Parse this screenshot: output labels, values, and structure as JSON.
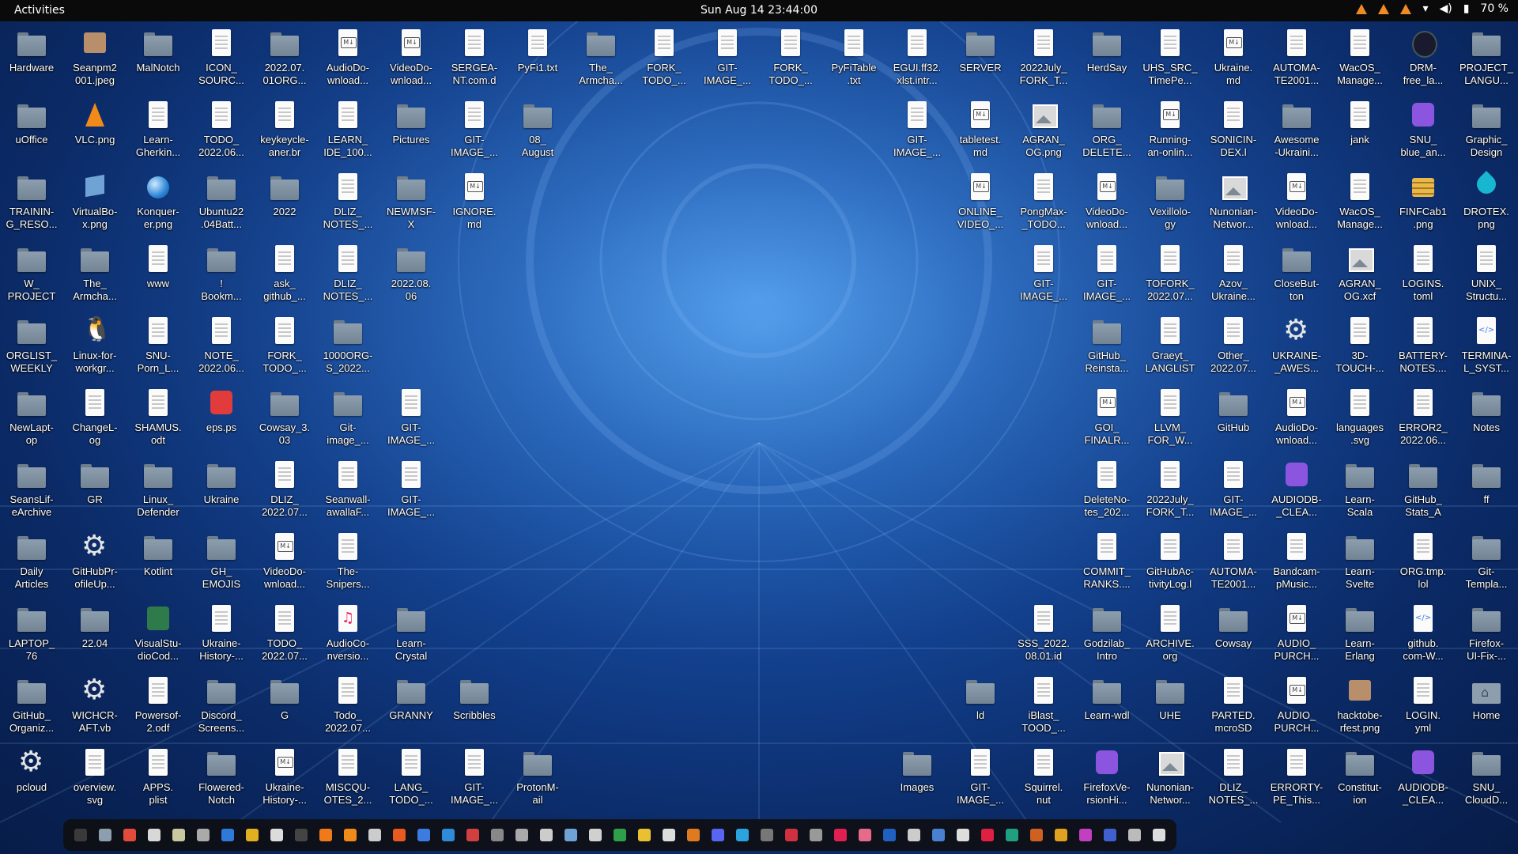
{
  "topbar": {
    "activities": "Activities",
    "clock": "Sun Aug 14  23:44:00",
    "battery": "70 %",
    "tray_icons": [
      "warning-icon",
      "warning-icon",
      "warning-icon",
      "wifi-icon",
      "volume-icon",
      "battery-icon"
    ]
  },
  "colors": {
    "desktop_accent": "#1f5fb8",
    "topbar": "#0a0a0a",
    "folder": "#8d9eae",
    "warning": "#f08a24"
  },
  "desktop": {
    "items": [
      {
        "label": "Hardware",
        "icon": "folder"
      },
      {
        "label": "Seanpm2\n001.jpeg",
        "icon": "pic"
      },
      {
        "label": "MalNotch",
        "icon": "folder"
      },
      {
        "label": "ICON_\nSOURC...",
        "icon": "doc"
      },
      {
        "label": "2022.07.\n01ORG...",
        "icon": "folder"
      },
      {
        "label": "AudioDo-\nwnload...",
        "icon": "md"
      },
      {
        "label": "VideoDo-\nwnload...",
        "icon": "md"
      },
      {
        "label": "SERGEA-\nNT.com.d",
        "icon": "doc"
      },
      {
        "label": "PyFi1.txt",
        "icon": "doc"
      },
      {
        "label": "The_\nArmcha...",
        "icon": "folder"
      },
      {
        "label": "FORK_\nTODO_...",
        "icon": "doc"
      },
      {
        "label": "GIT-\nIMAGE_...",
        "icon": "doc"
      },
      {
        "label": "FORK_\nTODO_...",
        "icon": "doc"
      },
      {
        "label": "PyFiTable\n.txt",
        "icon": "doc"
      },
      {
        "label": "EGUI.ff32.\nxlst.intr...",
        "icon": "doc"
      },
      {
        "label": "SERVER",
        "icon": "folder"
      },
      {
        "label": "2022July_\nFORK_T...",
        "icon": "doc"
      },
      {
        "label": "HerdSay",
        "icon": "folder"
      },
      {
        "label": "UHS_SRC_\nTimePe...",
        "icon": "doc"
      },
      {
        "label": "Ukraine.\nmd",
        "icon": "md"
      },
      {
        "label": "AUTOMA-\nTE2001...",
        "icon": "doc"
      },
      {
        "label": "WacOS_\nManage...",
        "icon": "doc"
      },
      {
        "label": "DRM-\nfree_la...",
        "icon": "dark"
      },
      {
        "label": "PROJECT_\nLANGU...",
        "icon": "folder"
      },
      {
        "label": "uOffice",
        "icon": "folder"
      },
      {
        "label": "VLC.png",
        "icon": "vlc"
      },
      {
        "label": "Learn-\nGherkin...",
        "icon": "doc"
      },
      {
        "label": "TODO_\n2022.06...",
        "icon": "doc"
      },
      {
        "label": "keykeycle-\naner.br",
        "icon": "doc"
      },
      {
        "label": "LEARN_\nIDE_100...",
        "icon": "doc"
      },
      {
        "label": "Pictures",
        "icon": "folder"
      },
      {
        "label": "GIT-\nIMAGE_...",
        "icon": "doc"
      },
      {
        "label": "08_\nAugust",
        "icon": "folder"
      },
      {
        "label": "GIT-\nIMAGE_...",
        "icon": "doc"
      },
      {
        "label": "tabletest.\nmd",
        "icon": "md"
      },
      {
        "label": "AGRAN_\nOG.png",
        "icon": "img"
      },
      {
        "label": "ORG_\nDELETE...",
        "icon": "folder"
      },
      {
        "label": "Running-\nan-onlin...",
        "icon": "md"
      },
      {
        "label": "SONICIN-\nDEX.l",
        "icon": "doc"
      },
      {
        "label": "Awesome\n-Ukraini...",
        "icon": "folder"
      },
      {
        "label": "jank",
        "icon": "doc"
      },
      {
        "label": "SNU_\nblue_an...",
        "icon": "purple"
      },
      {
        "label": "Graphic_\nDesign",
        "icon": "folder"
      },
      {
        "label": "TRAININ-\nG_RESO...",
        "icon": "folder"
      },
      {
        "label": "VirtualBo-\nx.png",
        "icon": "box"
      },
      {
        "label": "Konquer-\ner.png",
        "icon": "globe"
      },
      {
        "label": "Ubuntu22\n.04Batt...",
        "icon": "folder"
      },
      {
        "label": "2022",
        "icon": "folder"
      },
      {
        "label": "DLIZ_\nNOTES_...",
        "icon": "doc"
      },
      {
        "label": "NEWMSF-\nX",
        "icon": "folder"
      },
      {
        "label": "IGNORE.\nmd",
        "icon": "md"
      },
      {
        "label": "ONLINE_\nVIDEO_...",
        "icon": "md"
      },
      {
        "label": "PongMax-\n_TODO...",
        "icon": "doc"
      },
      {
        "label": "VideoDo-\nwnload...",
        "icon": "md"
      },
      {
        "label": "Vexillolo-\ngy",
        "icon": "folder"
      },
      {
        "label": "Nunonian-\nNetwor...",
        "icon": "img"
      },
      {
        "label": "VideoDo-\nwnload...",
        "icon": "md"
      },
      {
        "label": "WacOS_\nManage...",
        "icon": "doc"
      },
      {
        "label": "FINFCab1\n.png",
        "icon": "stack"
      },
      {
        "label": "DROTEX.\npng",
        "icon": "drop"
      },
      {
        "label": "W_\nPROJECT",
        "icon": "folder"
      },
      {
        "label": "The_\nArmcha...",
        "icon": "folder"
      },
      {
        "label": "www",
        "icon": "doc"
      },
      {
        "label": "!\nBookm...",
        "icon": "folder"
      },
      {
        "label": "ask_\ngithub_...",
        "icon": "doc"
      },
      {
        "label": "DLIZ_\nNOTES_...",
        "icon": "doc"
      },
      {
        "label": "2022.08.\n06",
        "icon": "folder"
      },
      {
        "label": "GIT-\nIMAGE_...",
        "icon": "doc"
      },
      {
        "label": "GIT-\nIMAGE_...",
        "icon": "doc"
      },
      {
        "label": "TOFORK_\n2022.07...",
        "icon": "doc"
      },
      {
        "label": "Azov_\nUkraine...",
        "icon": "doc"
      },
      {
        "label": "CloseBut-\nton",
        "icon": "folder"
      },
      {
        "label": "AGRAN_\nOG.xcf",
        "icon": "img"
      },
      {
        "label": "LOGINS.\ntoml",
        "icon": "doc"
      },
      {
        "label": "UNIX_\nStructu...",
        "icon": "doc"
      },
      {
        "label": "ORGLIST_\nWEEKLY",
        "icon": "folder"
      },
      {
        "label": "Linux-for-\nworkgr...",
        "icon": "penguin"
      },
      {
        "label": "SNU-\nPorn_L...",
        "icon": "doc"
      },
      {
        "label": "NOTE_\n2022.06...",
        "icon": "doc"
      },
      {
        "label": "FORK_\nTODO_...",
        "icon": "doc"
      },
      {
        "label": "1000ORG-\nS_2022...",
        "icon": "folder"
      },
      {
        "label": "GitHub_\nReinsta...",
        "icon": "folder"
      },
      {
        "label": "Graeyt_\nLANGLIST",
        "icon": "doc"
      },
      {
        "label": "Other_\n2022.07...",
        "icon": "doc"
      },
      {
        "label": "UKRAINE-\n_AWES...",
        "icon": "gear"
      },
      {
        "label": "3D-\nTOUCH-...",
        "icon": "doc"
      },
      {
        "label": "BATTERY-\nNOTES....",
        "icon": "doc"
      },
      {
        "label": "TERMINA-\nL_SYST...",
        "icon": "code"
      },
      {
        "label": "NewLapt-\nop",
        "icon": "folder"
      },
      {
        "label": "ChangeL-\nog",
        "icon": "doc"
      },
      {
        "label": "SHAMUS.\nodt",
        "icon": "doc"
      },
      {
        "label": "eps.ps",
        "icon": "red"
      },
      {
        "label": "Cowsay_3.\n03",
        "icon": "folder"
      },
      {
        "label": "Git-\nimage_...",
        "icon": "folder"
      },
      {
        "label": "GIT-\nIMAGE_...",
        "icon": "doc"
      },
      {
        "label": "GOI_\nFINALR...",
        "icon": "md"
      },
      {
        "label": "LLVM_\nFOR_W...",
        "icon": "doc"
      },
      {
        "label": "GitHub",
        "icon": "folder"
      },
      {
        "label": "AudioDo-\nwnload...",
        "icon": "md"
      },
      {
        "label": "languages\n.svg",
        "icon": "doc"
      },
      {
        "label": "ERROR2_\n2022.06...",
        "icon": "doc"
      },
      {
        "label": "Notes",
        "icon": "folder"
      },
      {
        "label": "SeansLif-\neArchive",
        "icon": "folder"
      },
      {
        "label": "GR",
        "icon": "folder"
      },
      {
        "label": "Linux_\nDefender",
        "icon": "folder"
      },
      {
        "label": "Ukraine",
        "icon": "folder"
      },
      {
        "label": "DLIZ_\n2022.07...",
        "icon": "doc"
      },
      {
        "label": "Seanwall-\nawallaF...",
        "icon": "doc"
      },
      {
        "label": "GIT-\nIMAGE_...",
        "icon": "doc"
      },
      {
        "label": "DeleteNo-\ntes_202...",
        "icon": "doc"
      },
      {
        "label": "2022July_\nFORK_T...",
        "icon": "doc"
      },
      {
        "label": "GIT-\nIMAGE_...",
        "icon": "doc"
      },
      {
        "label": "AUDIODB-\n_CLEA...",
        "icon": "purple"
      },
      {
        "label": "Learn-\nScala",
        "icon": "folder"
      },
      {
        "label": "GitHub_\nStats_A",
        "icon": "folder"
      },
      {
        "label": "ff",
        "icon": "folder"
      },
      {
        "label": "Daily\nArticles",
        "icon": "folder"
      },
      {
        "label": "GitHubPr-\nofileUp...",
        "icon": "gear"
      },
      {
        "label": "Kotlint",
        "icon": "folder"
      },
      {
        "label": "GH_\nEMOJIS",
        "icon": "folder"
      },
      {
        "label": "VideoDo-\nwnload...",
        "icon": "md"
      },
      {
        "label": "The-\nSnipers...",
        "icon": "doc"
      },
      {
        "label": "COMMIT_\nRANKS....",
        "icon": "doc"
      },
      {
        "label": "GitHubAc-\ntivityLog.l",
        "icon": "doc"
      },
      {
        "label": "AUTOMA-\nTE2001...",
        "icon": "doc"
      },
      {
        "label": "Bandcam-\npMusic...",
        "icon": "doc"
      },
      {
        "label": "Learn-\nSvelte",
        "icon": "folder"
      },
      {
        "label": "ORG.tmp.\nlol",
        "icon": "doc"
      },
      {
        "label": "Git-\nTempla...",
        "icon": "folder"
      },
      {
        "label": "LAPTOP_\n76",
        "icon": "folder"
      },
      {
        "label": "22.04",
        "icon": "folder"
      },
      {
        "label": "VisualStu-\ndioCod...",
        "icon": "vscode"
      },
      {
        "label": "Ukraine-\nHistory-...",
        "icon": "doc"
      },
      {
        "label": "TODO_\n2022.07...",
        "icon": "doc"
      },
      {
        "label": "AudioCo-\nnversio...",
        "icon": "music"
      },
      {
        "label": "Learn-\nCrystal",
        "icon": "folder"
      },
      {
        "label": "SSS_2022.\n08.01.id",
        "icon": "doc"
      },
      {
        "label": "Godzilab_\nIntro",
        "icon": "folder"
      },
      {
        "label": "ARCHIVE.\norg",
        "icon": "doc"
      },
      {
        "label": "Cowsay",
        "icon": "folder"
      },
      {
        "label": "AUDIO_\nPURCH...",
        "icon": "md"
      },
      {
        "label": "Learn-\nErlang",
        "icon": "folder"
      },
      {
        "label": "github.\ncom-W...",
        "icon": "code"
      },
      {
        "label": "Firefox-\nUI-Fix-...",
        "icon": "folder"
      },
      {
        "label": "GitHub_\nOrganiz...",
        "icon": "folder"
      },
      {
        "label": "WICHCR-\nAFT.vb",
        "icon": "gear"
      },
      {
        "label": "Powersof-\n2.odf",
        "icon": "doc"
      },
      {
        "label": "Discord_\nScreens...",
        "icon": "folder"
      },
      {
        "label": "G",
        "icon": "folder"
      },
      {
        "label": "Todo_\n2022.07...",
        "icon": "doc"
      },
      {
        "label": "GRANNY",
        "icon": "folder"
      },
      {
        "label": "Scribbles",
        "icon": "folder"
      },
      {
        "label": "ld",
        "icon": "folder"
      },
      {
        "label": "iBlast_\nTOOD_...",
        "icon": "doc"
      },
      {
        "label": "Learn-wdl",
        "icon": "folder"
      },
      {
        "label": "UHE",
        "icon": "folder"
      },
      {
        "label": "PARTED.\nmcroSD",
        "icon": "doc"
      },
      {
        "label": "AUDIO_\nPURCH...",
        "icon": "md"
      },
      {
        "label": "hacktobe-\nrfest.png",
        "icon": "pic"
      },
      {
        "label": "LOGIN.\nyml",
        "icon": "doc"
      },
      {
        "label": "Home",
        "icon": "home"
      },
      {
        "label": "pcloud",
        "icon": "gear"
      },
      {
        "label": "overview.\nsvg",
        "icon": "doc"
      },
      {
        "label": "APPS.\nplist",
        "icon": "doc"
      },
      {
        "label": "Flowered-\nNotch",
        "icon": "folder"
      },
      {
        "label": "Ukraine-\nHistory-...",
        "icon": "md"
      },
      {
        "label": "MISCQU-\nOTES_2...",
        "icon": "doc"
      },
      {
        "label": "LANG_\nTODO_...",
        "icon": "doc"
      },
      {
        "label": "GIT-\nIMAGE_...",
        "icon": "doc"
      },
      {
        "label": "ProtonM-\nail",
        "icon": "folder"
      },
      {
        "label": "Images",
        "icon": "folder"
      },
      {
        "label": "GIT-\nIMAGE_...",
        "icon": "doc"
      },
      {
        "label": "Squirrel.\nnut",
        "icon": "doc"
      },
      {
        "label": "FirefoxVe-\nrsionHi...",
        "icon": "purple"
      },
      {
        "label": "Nunonian-\nNetwor...",
        "icon": "img"
      },
      {
        "label": "DLIZ_\nNOTES_...",
        "icon": "doc"
      },
      {
        "label": "ERRORTY-\nPE_This...",
        "icon": "doc"
      },
      {
        "label": "Constitut-\nion",
        "icon": "folder"
      },
      {
        "label": "AUDIODB-\n_CLEA...",
        "icon": "purple"
      },
      {
        "label": "SNU_\nCloudD...",
        "icon": "folder"
      }
    ]
  },
  "dock": {
    "apps": [
      {
        "name": "terminal",
        "color": "#3a3a3a"
      },
      {
        "name": "files",
        "color": "#8d9eae"
      },
      {
        "name": "chrome",
        "color": "#e24a3b"
      },
      {
        "name": "editor",
        "color": "#d8d8d8"
      },
      {
        "name": "notes",
        "color": "#c8c8a0"
      },
      {
        "name": "screenshot",
        "color": "#aaaaaa"
      },
      {
        "name": "writer",
        "color": "#2f7ad8"
      },
      {
        "name": "calc",
        "color": "#e0b020"
      },
      {
        "name": "gedit",
        "color": "#dcdcdc"
      },
      {
        "name": "console",
        "color": "#444444"
      },
      {
        "name": "firefox",
        "color": "#f07a1a"
      },
      {
        "name": "vlc",
        "color": "#f28a1a"
      },
      {
        "name": "obs",
        "color": "#cccccc"
      },
      {
        "name": "software",
        "color": "#e85a20"
      },
      {
        "name": "docs",
        "color": "#3c7be0"
      },
      {
        "name": "help",
        "color": "#2f8ad8"
      },
      {
        "name": "monitor",
        "color": "#d04040"
      },
      {
        "name": "settings",
        "color": "#888888"
      },
      {
        "name": "tool",
        "color": "#aaaaaa"
      },
      {
        "name": "up",
        "color": "#cccccc"
      },
      {
        "name": "virtualbox",
        "color": "#6fa3d6"
      },
      {
        "name": "camera",
        "color": "#d0d0d0"
      },
      {
        "name": "sheet",
        "color": "#2fa04a"
      },
      {
        "name": "mail",
        "color": "#e8c030"
      },
      {
        "name": "doc",
        "color": "#dddddd"
      },
      {
        "name": "pdf",
        "color": "#e07a20"
      },
      {
        "name": "discord",
        "color": "#5865f2"
      },
      {
        "name": "telegram",
        "color": "#2aa3df"
      },
      {
        "name": "steam",
        "color": "#777777"
      },
      {
        "name": "app1",
        "color": "#d03040"
      },
      {
        "name": "app2",
        "color": "#999999"
      },
      {
        "name": "app3",
        "color": "#e02050"
      },
      {
        "name": "app4",
        "color": "#e86a8a"
      },
      {
        "name": "app5",
        "color": "#2060c0"
      },
      {
        "name": "app6",
        "color": "#cccccc"
      },
      {
        "name": "app7",
        "color": "#4a80d0"
      },
      {
        "name": "app8",
        "color": "#dddddd"
      },
      {
        "name": "app9",
        "color": "#e02040"
      },
      {
        "name": "app10",
        "color": "#20a080"
      },
      {
        "name": "app11",
        "color": "#d06020"
      },
      {
        "name": "app12",
        "color": "#e0a020"
      },
      {
        "name": "app13",
        "color": "#c040c0"
      },
      {
        "name": "app14",
        "color": "#4060d0"
      },
      {
        "name": "trash",
        "color": "#bbbbbb"
      },
      {
        "name": "show-apps",
        "color": "#dddddd"
      }
    ]
  }
}
